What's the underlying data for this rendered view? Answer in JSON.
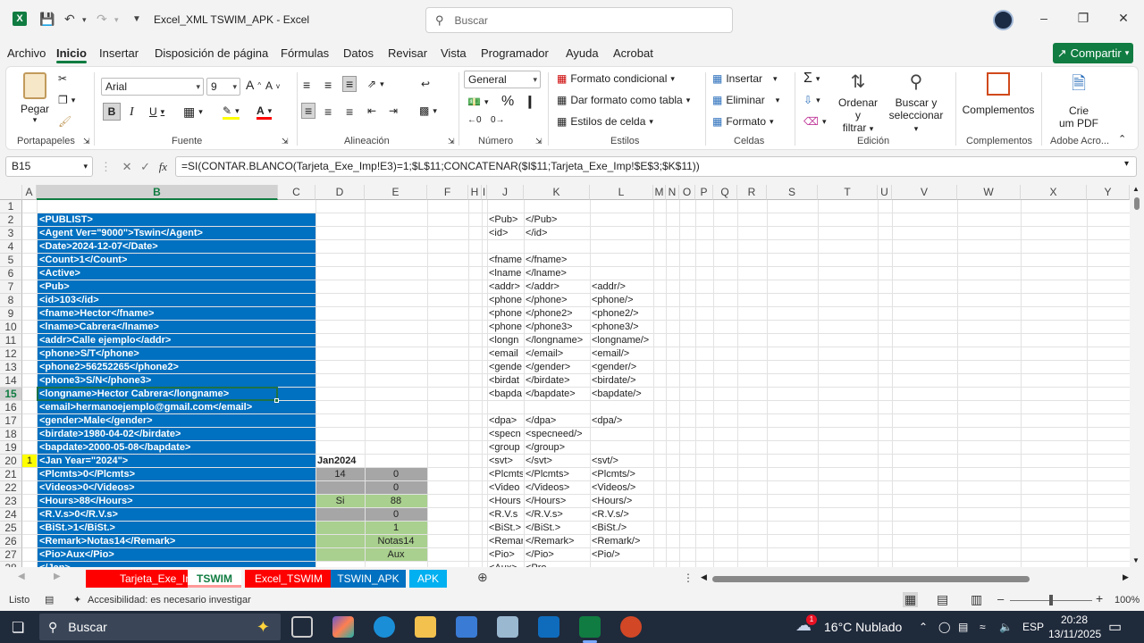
{
  "window": {
    "title": "Excel_XML TSWIM_APK  -  Excel",
    "search_placeholder": "Buscar"
  },
  "ribbon_tabs": [
    "Archivo",
    "Inicio",
    "Insertar",
    "Disposición de página",
    "Fórmulas",
    "Datos",
    "Revisar",
    "Vista",
    "Programador",
    "Ayuda",
    "Acrobat"
  ],
  "share_label": "Compartir",
  "ribbon": {
    "paste": "Pegar",
    "font_name": "Arial",
    "font_size": "9",
    "number_format": "General",
    "cond_format": "Formato condicional",
    "format_table": "Dar formato como tabla",
    "cell_styles": "Estilos de celda",
    "insert": "Insertar",
    "delete": "Eliminar",
    "format": "Formato",
    "sort_filter_1": "Ordenar y",
    "sort_filter_2": "filtrar",
    "find_select_1": "Buscar y",
    "find_select_2": "seleccionar",
    "addins": "Complementos",
    "pdf_1": "Crie",
    "pdf_2": "um PDF",
    "groups": {
      "clipboard": "Portapapeles",
      "font": "Fuente",
      "alignment": "Alineación",
      "number": "Número",
      "styles": "Estilos",
      "cells": "Celdas",
      "editing": "Edición",
      "addins": "Complementos",
      "adobe": "Adobe Acro..."
    }
  },
  "formula_bar": {
    "name_box": "B15",
    "formula": "=SI(CONTAR.BLANCO(Tarjeta_Exe_Imp!E3)=1;$L$11;CONCATENAR($I$11;Tarjeta_Exe_Imp!$E$3;$K$11))"
  },
  "columns": [
    "A",
    "B",
    "C",
    "D",
    "E",
    "F",
    "H",
    "I",
    "J",
    "K",
    "L",
    "M",
    "N",
    "O",
    "P",
    "Q",
    "R",
    "S",
    "T",
    "U",
    "V",
    "W",
    "X",
    "Y"
  ],
  "rows": [
    "1",
    "2",
    "3",
    "4",
    "5",
    "6",
    "7",
    "8",
    "9",
    "10",
    "11",
    "12",
    "13",
    "14",
    "15",
    "16",
    "17",
    "18",
    "19",
    "20",
    "21",
    "22",
    "23",
    "24",
    "25",
    "26",
    "27",
    "28"
  ],
  "colB": [
    "",
    "<PUBLIST>",
    "<Agent Ver=\"9000\">Tswin</Agent>",
    "<Date>2024-12-07</Date>",
    "<Count>1</Count>",
    "<Active>",
    "<Pub>",
    "<id>103</id>",
    "<fname>Hector</fname>",
    "<lname>Cabrera</lname>",
    "<addr>Calle ejemplo</addr>",
    "<phone>S/T</phone>",
    "<phone2>56252265</phone2>",
    "<phone3>S/N</phone3>",
    "<longname>Hector Cabrera</longname>",
    "<email>hermanoejemplo@gmail.com</email>",
    "<gender>Male</gender>",
    "<birdate>1980-04-02</birdate>",
    "<bapdate>2000-05-08</bapdate>",
    "<Jan Year=\"2024\">",
    "<Plcmts>0</Plcmts>",
    "<Videos>0</Videos>",
    "<Hours>88</Hours>",
    "<R.V.s>0</R.V.s>",
    "<BiSt.>1</BiSt.>",
    "<Remark>Notas14</Remark>",
    "<Pio>Aux</Pio>",
    "</Jan>"
  ],
  "colJ": [
    "",
    "<Pub>",
    "<id>",
    "",
    "<fname",
    "<lname",
    "<addr>",
    "<phone",
    "<phone",
    "<phone",
    "<longn",
    "<email",
    "<gende",
    "<birdat",
    "<bapda",
    "",
    "<dpa>",
    "<specn",
    "<group",
    "<svt>",
    "<Plcmts",
    "<Video",
    "<Hours",
    "<R.V.s",
    "<BiSt.>",
    "<Remar",
    "<Pio>",
    "<Aux>"
  ],
  "colK": [
    "",
    "</Pub>",
    "</id>",
    "",
    "</fname>",
    "</lname>",
    "</addr>",
    "</phone>",
    "</phone2>",
    "</phone3>",
    "</longname>",
    "</email>",
    "</gender>",
    "</birdate>",
    "</bapdate>",
    "",
    "</dpa>",
    "<specneed/>",
    "</group>",
    "</svt>",
    "</Plcmts>",
    "</Videos>",
    "</Hours>",
    "</R.V.s>",
    "</BiSt.>",
    "</Remark>",
    "</Pio>",
    "<Pro"
  ],
  "colL": [
    "",
    "",
    "",
    "",
    "",
    "",
    "<addr/>",
    "<phone/>",
    "<phone2/>",
    "<phone3/>",
    "<longname/>",
    "<email/>",
    "<gender/>",
    "<birdate/>",
    "<bapdate/>",
    "",
    "<dpa/>",
    "",
    "",
    "<svt/>",
    "<Plcmts/>",
    "<Videos/>",
    "<Hours/>",
    "<R.V.s/>",
    "<BiSt./>",
    "<Remark/>",
    "<Pio/>",
    ""
  ],
  "cells": {
    "a20": "1",
    "d20": "Jan2024",
    "d21": "14",
    "d23": "Si",
    "e21": "0",
    "e22": "0",
    "e23": "88",
    "e24": "0",
    "e25": "1",
    "e26": "Notas14",
    "e27": "Aux"
  },
  "sheet_tabs": [
    {
      "name": "Tarjeta_Exe_Imp",
      "color": "#ff0000"
    },
    {
      "name": "TSWIM",
      "color": "#ff9999"
    },
    {
      "name": "Excel_TSWIM",
      "color": "#ff0000"
    },
    {
      "name": "TSWIN_APK",
      "color": "#0070c0"
    },
    {
      "name": "APK",
      "color": "#00b0f0"
    }
  ],
  "status": {
    "ready": "Listo",
    "accessibility": "Accesibilidad: es necesario investigar",
    "zoom": "100%"
  },
  "taskbar": {
    "search": "Buscar",
    "weather": "16°C  Nublado",
    "lang": "ESP",
    "time": "20:28",
    "date": "13/11/2025",
    "badge": "1"
  }
}
